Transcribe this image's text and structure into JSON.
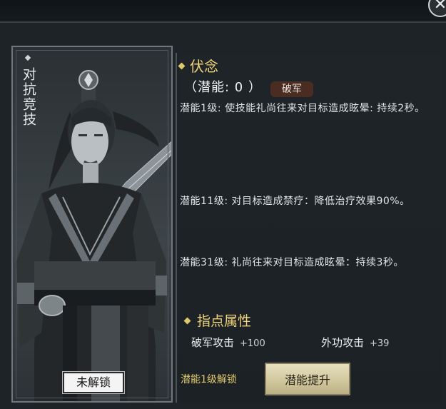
{
  "window": {
    "close_icon": "close-icon"
  },
  "card": {
    "title": "对抗竞技",
    "lock_label": "未解锁"
  },
  "skill": {
    "name": "伏念",
    "potential_label": "（潜能: 0 ）",
    "tag": "破军",
    "descriptions": [
      "潜能1级: 使技能礼尚往来对目标造成眩晕: 持续2秒。",
      "潜能11级: 对目标造成禁疗：降低治疗效果90%。",
      "潜能31级: 礼尚往来对目标造成眩晕：持续3秒。"
    ]
  },
  "attributes": {
    "title": "指点属性",
    "items": [
      {
        "name": "破军攻击",
        "value": "+100"
      },
      {
        "name": "外功攻击",
        "value": "+39"
      }
    ]
  },
  "footer": {
    "unlock_text": "潜能1级解锁",
    "upgrade_button": "潜能提升"
  },
  "colors": {
    "gold": "#f0d27a",
    "panel": "#1e2428",
    "tag": "#4a2c22"
  }
}
